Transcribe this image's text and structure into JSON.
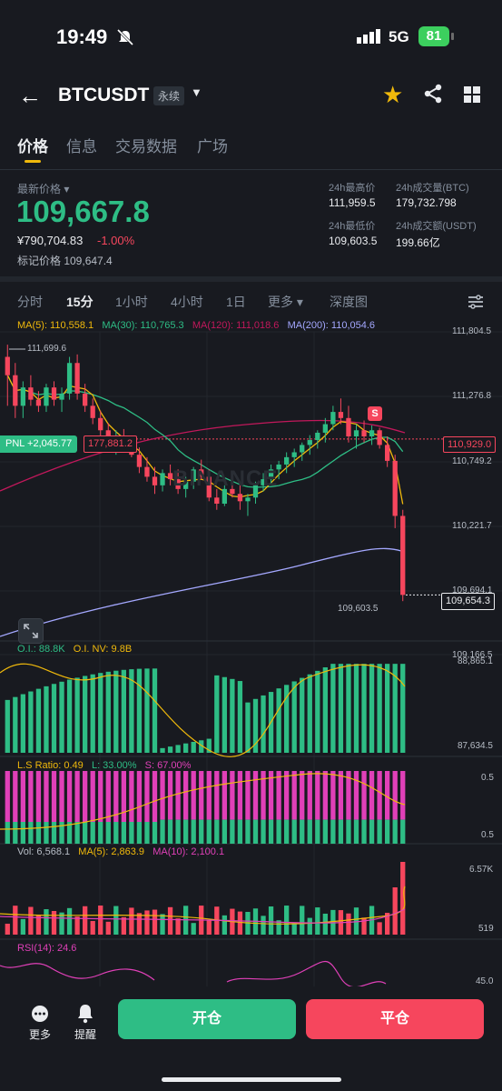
{
  "status": {
    "time": "19:49",
    "network": "5G",
    "battery": "81"
  },
  "header": {
    "symbol": "BTCUSDT",
    "contract": "永续"
  },
  "tabs": [
    "价格",
    "信息",
    "交易数据",
    "广场"
  ],
  "price": {
    "label": "最新价格",
    "last": "109,667.8",
    "cny": "¥790,704.83",
    "change": "-1.00%",
    "mark": "标记价格 109,647.4"
  },
  "stats": {
    "high_label": "24h最高价",
    "high": "111,959.5",
    "low_label": "24h最低价",
    "low": "109,603.5",
    "vol_btc_label": "24h成交量(BTC)",
    "vol_btc": "179,732.798",
    "vol_usdt_label": "24h成交额(USDT)",
    "vol_usdt": "199.66亿"
  },
  "timeframes": [
    "分时",
    "15分",
    "1小时",
    "4小时",
    "1日",
    "更多",
    "深度图"
  ],
  "ma": {
    "ma5": "MA(5): 110,558.1",
    "ma30": "MA(30): 110,765.3",
    "ma120": "MA(120): 111,018.6",
    "ma200": "MA(200): 110,054.6"
  },
  "main_chart": {
    "axis": [
      "111,804.5",
      "111,276.8",
      "110,749.2",
      "110,221.7",
      "109,694.1",
      "109,166.5"
    ],
    "high_marker": "111,699.6",
    "low_marker": "109,603.5",
    "position_label": "PNL +2,045.77",
    "position_price": "177,881.2",
    "order_price": "110,929.0",
    "current_price": "109,654.3",
    "s_marker": "S",
    "watermark": "BINANCE"
  },
  "oi": {
    "oi": "O.I.: 88.8K",
    "nv": "O.I. NV: 9.8B",
    "axis_top": "88,865.1",
    "axis_bottom": "87,634.5"
  },
  "ls": {
    "ratio": "L.S Ratio: 0.49",
    "long": "L: 33.00%",
    "short": "S: 67.00%",
    "axis_top": "0.5",
    "axis_bottom": "0.5"
  },
  "vol": {
    "vol": "Vol: 6,568.1",
    "ma5": "MA(5): 2,863.9",
    "ma10": "MA(10): 2,100.1",
    "axis_top": "6.57K",
    "axis_bottom": "519"
  },
  "rsi": {
    "label": "RSI(14): 24.6",
    "axis": "45.0"
  },
  "bottom": {
    "more": "更多",
    "alert": "提醒",
    "open": "开仓",
    "close": "平仓"
  },
  "colors": {
    "up": "#2ebd85",
    "down": "#f6465d",
    "accent": "#f0b90b",
    "bg": "#181a20"
  },
  "chart_data": {
    "type": "candlestick",
    "interval": "15分",
    "ylim": [
      109166.5,
      111804.5
    ],
    "candles": [
      [
        111600,
        111699.6,
        111200,
        111450
      ],
      [
        111450,
        111550,
        111100,
        111200
      ],
      [
        111200,
        111400,
        111100,
        111350
      ],
      [
        111350,
        111450,
        111200,
        111250
      ],
      [
        111250,
        111320,
        111150,
        111200
      ],
      [
        111200,
        111380,
        111150,
        111350
      ],
      [
        111350,
        111400,
        111200,
        111250
      ],
      [
        111250,
        111350,
        111150,
        111300
      ],
      [
        111300,
        111600,
        111250,
        111550
      ],
      [
        111550,
        111620,
        111250,
        111300
      ],
      [
        111300,
        111380,
        111150,
        111200
      ],
      [
        111200,
        111260,
        111050,
        111100
      ],
      [
        111100,
        111160,
        110950,
        111000
      ],
      [
        111000,
        111060,
        110850,
        110900
      ],
      [
        110900,
        111000,
        110800,
        110950
      ],
      [
        110950,
        111010,
        110820,
        110880
      ],
      [
        110880,
        110950,
        110780,
        110800
      ],
      [
        110800,
        110860,
        110650,
        110700
      ],
      [
        110700,
        110780,
        110580,
        110620
      ],
      [
        110620,
        110700,
        110480,
        110550
      ],
      [
        110550,
        110680,
        110500,
        110650
      ],
      [
        110650,
        110720,
        110550,
        110600
      ],
      [
        110600,
        110680,
        110480,
        110520
      ],
      [
        110520,
        110620,
        110450,
        110580
      ],
      [
        110580,
        110700,
        110520,
        110680
      ],
      [
        110680,
        110760,
        110600,
        110620
      ],
      [
        110620,
        110680,
        110420,
        110450
      ],
      [
        110450,
        110520,
        110350,
        110400
      ],
      [
        110400,
        110550,
        110380,
        110520
      ],
      [
        110520,
        110620,
        110450,
        110480
      ],
      [
        110480,
        110550,
        110350,
        110420
      ],
      [
        110420,
        110480,
        110300,
        110450
      ],
      [
        110450,
        110580,
        110400,
        110550
      ],
      [
        110550,
        110650,
        110500,
        110600
      ],
      [
        110600,
        110720,
        110550,
        110680
      ],
      [
        110680,
        110750,
        110600,
        110720
      ],
      [
        110720,
        110820,
        110650,
        110780
      ],
      [
        110780,
        110850,
        110700,
        110820
      ],
      [
        110820,
        110900,
        110750,
        110880
      ],
      [
        110880,
        110960,
        110800,
        110920
      ],
      [
        110920,
        111000,
        110850,
        110980
      ],
      [
        110980,
        111100,
        110900,
        111050
      ],
      [
        111050,
        111200,
        111000,
        111150
      ],
      [
        111150,
        111260,
        111050,
        111100
      ],
      [
        111100,
        111200,
        110900,
        110950
      ],
      [
        110950,
        111050,
        110850,
        111000
      ],
      [
        111000,
        111080,
        110900,
        110950
      ],
      [
        110950,
        111040,
        110880,
        111000
      ],
      [
        111000,
        111020,
        110850,
        110880
      ],
      [
        110880,
        110950,
        110700,
        110750
      ],
      [
        110750,
        110800,
        110200,
        110300
      ],
      [
        110300,
        110350,
        109603.5,
        109654.3
      ]
    ]
  }
}
